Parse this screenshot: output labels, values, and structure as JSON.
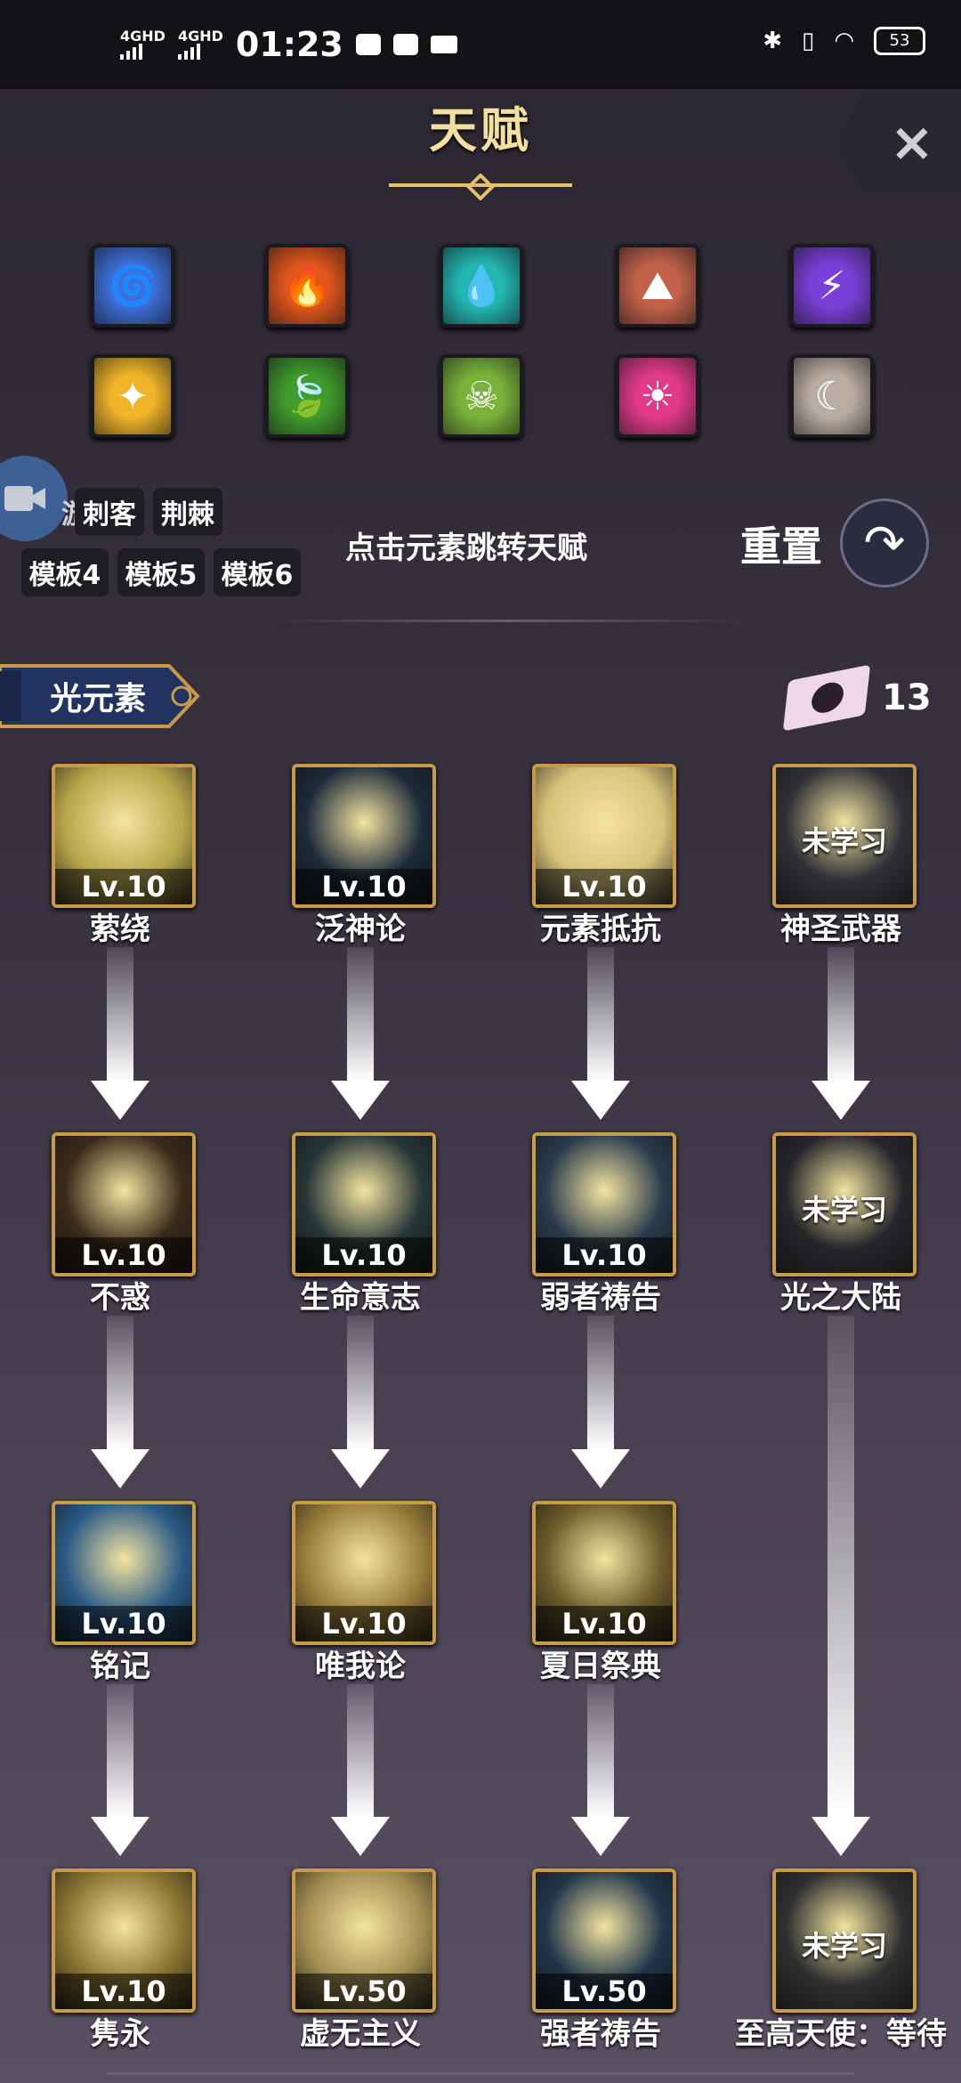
{
  "status_bar": {
    "net1": "4GHD",
    "net2": "4GHD",
    "time": "01:23",
    "battery": "53"
  },
  "header": {
    "title": "天赋",
    "close_label": "×"
  },
  "elements": [
    {
      "icon": "tornado-icon",
      "color": "#3d6fd8",
      "glyph": "🌀"
    },
    {
      "icon": "fire-icon",
      "color": "#e0561c",
      "glyph": "🔥"
    },
    {
      "icon": "water-drop-icon",
      "color": "#22b7b2",
      "glyph": "💧"
    },
    {
      "icon": "earth-crack-icon",
      "color": "#c2624a",
      "glyph": "⛰"
    },
    {
      "icon": "lightning-icon",
      "color": "#7a3fd6",
      "glyph": "⚡"
    },
    {
      "icon": "light-crystal-icon",
      "color": "#f0b428",
      "glyph": "✦"
    },
    {
      "icon": "leaf-icon",
      "color": "#3f9b2c",
      "glyph": "🍃"
    },
    {
      "icon": "skull-icon",
      "color": "#7ab33a",
      "glyph": "☠"
    },
    {
      "icon": "sun-icon",
      "color": "#e23a8a",
      "glyph": "☀"
    },
    {
      "icon": "moon-icon",
      "color": "#b9aca2",
      "glyph": "☾"
    }
  ],
  "templates": {
    "row1": [
      "游",
      "刺客",
      "荆棘"
    ],
    "row2": [
      "模板4",
      "模板5",
      "模板6"
    ]
  },
  "hint": "点击元素跳转天赋",
  "reset_label": "重置",
  "section": {
    "name": "光元素",
    "points": "13"
  },
  "skills": [
    {
      "name": "萦绕",
      "level": "Lv.10",
      "art": "#b9a64a"
    },
    {
      "name": "泛神论",
      "level": "Lv.10",
      "art": "#1d2a3a"
    },
    {
      "name": "元素抵抗",
      "level": "Lv.10",
      "art": "#d7c27a"
    },
    {
      "name": "神圣武器",
      "level": "未学习",
      "art": "#2e3036"
    },
    {
      "name": "不惑",
      "level": "Lv.10",
      "art": "#3a2a1a"
    },
    {
      "name": "生命意志",
      "level": "Lv.10",
      "art": "#263536"
    },
    {
      "name": "弱者祷告",
      "level": "Lv.10",
      "art": "#2a3b4c"
    },
    {
      "name": "光之大陆",
      "level": "未学习",
      "art": "#25262b"
    },
    {
      "name": "铭记",
      "level": "Lv.10",
      "art": "#2b5a86"
    },
    {
      "name": "唯我论",
      "level": "Lv.10",
      "art": "#9a7d3a"
    },
    {
      "name": "夏日祭典",
      "level": "Lv.10",
      "art": "#6b5a2a"
    },
    {
      "name": "隽永",
      "level": "Lv.10",
      "art": "#8a7432"
    },
    {
      "name": "虚无主义",
      "level": "Lv.50",
      "art": "#a38e52"
    },
    {
      "name": "强者祷告",
      "level": "Lv.50",
      "art": "#20364a"
    },
    {
      "name": "至高天使：等待",
      "level": "未学习",
      "art": "#2d2f30"
    }
  ]
}
